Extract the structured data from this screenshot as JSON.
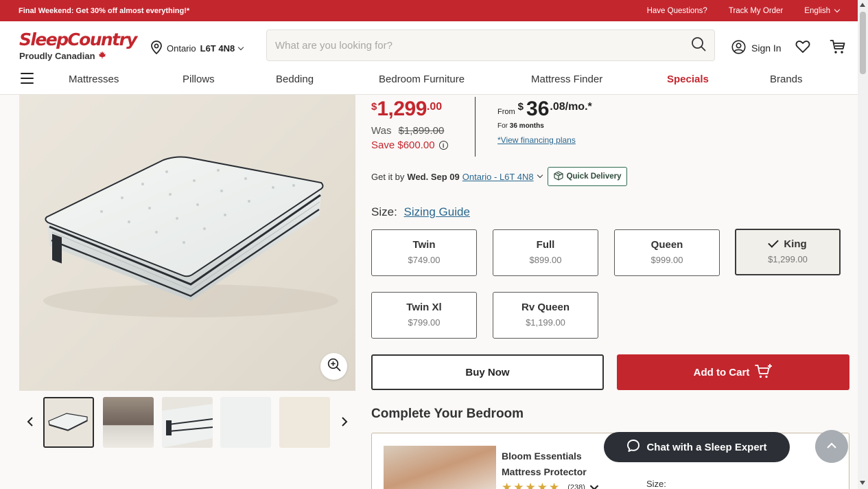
{
  "promo": {
    "text": "Final Weekend: Get 30% off almost everything!*",
    "links": [
      "Have Questions?",
      "Track My Order",
      "English"
    ]
  },
  "header": {
    "logo": "SleepCountry",
    "tagline": "Proudly Canadian",
    "location_region": "Ontario",
    "location_postal": "L6T 4N8",
    "search_placeholder": "What are you looking for?",
    "sign_in": "Sign In"
  },
  "nav": {
    "items": [
      "Mattresses",
      "Pillows",
      "Bedding",
      "Bedroom Furniture",
      "Mattress Finder",
      "Specials",
      "Brands"
    ]
  },
  "price": {
    "currency": "$",
    "amount": "1,299",
    "cents": ".00",
    "was_label": "Was",
    "was_price": "$1,899.00",
    "save": "Save $600.00"
  },
  "finance": {
    "from": "From",
    "currency": "$",
    "amount": "36",
    "rest": ".08/mo.*",
    "for_prefix": "For",
    "months": "36 months",
    "link": "*View financing plans"
  },
  "delivery": {
    "prefix": "Get it by",
    "date": "Wed. Sep 09",
    "location": "Ontario - L6T 4N8",
    "badge": "Quick Delivery"
  },
  "size": {
    "label": "Size:",
    "guide": "Sizing Guide",
    "options": [
      {
        "name": "Twin",
        "price": "$749.00"
      },
      {
        "name": "Full",
        "price": "$899.00"
      },
      {
        "name": "Queen",
        "price": "$999.00"
      },
      {
        "name": "King",
        "price": "$1,299.00"
      },
      {
        "name": "Twin Xl",
        "price": "$799.00"
      },
      {
        "name": "Rv Queen",
        "price": "$1,199.00"
      }
    ],
    "selected": "King"
  },
  "actions": {
    "buy_now": "Buy Now",
    "add_to_cart": "Add to Cart"
  },
  "complete": {
    "title": "Complete Your Bedroom",
    "product_name": "Bloom Essentials Mattress Protector",
    "review_count": "(238)",
    "size_label": "Size:"
  },
  "chat": {
    "label": "Chat with a Sleep Expert"
  },
  "colors": {
    "brand_red": "#c4262e",
    "chat_dark": "#2c3036",
    "link_blue": "#2a6790",
    "quick_green": "#2e6a4f",
    "star_gold": "#d7a83b"
  }
}
